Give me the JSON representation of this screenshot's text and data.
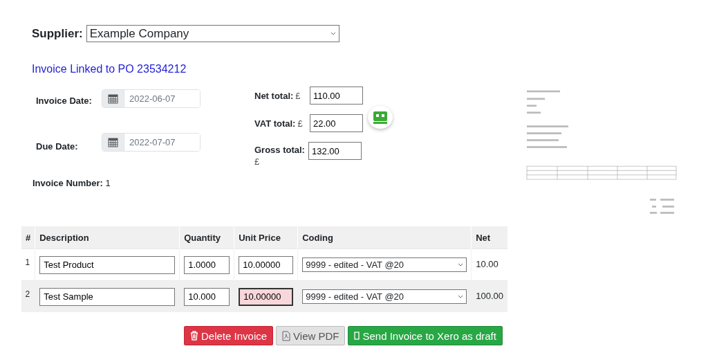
{
  "supplier": {
    "label": "Supplier:",
    "value": "Example Company"
  },
  "po_link": "Invoice Linked to PO 23534212",
  "dates": [
    {
      "label": "Invoice Date:",
      "placeholder": "2022-06-07"
    },
    {
      "label": "Due Date:",
      "placeholder": "2022-07-07"
    }
  ],
  "invoice_number": {
    "label": "Invoice Number:",
    "value": "1"
  },
  "totals": [
    {
      "label": "Net total:",
      "currency": "£",
      "value": "110.00"
    },
    {
      "label": "VAT total:",
      "currency": "£",
      "value": "22.00"
    },
    {
      "label": "Gross total:",
      "currency": "£",
      "value": "132.00"
    }
  ],
  "table": {
    "columns": [
      "#",
      "Description",
      "Quantity",
      "Unit Price",
      "Coding",
      "Net"
    ],
    "rows": [
      {
        "index": "1",
        "description": "Test Product",
        "quantity": "1.0000",
        "unit_price": "10.00000",
        "unit_price_invalid": false,
        "coding": "9999 - edited - VAT @20",
        "net": "10.00"
      },
      {
        "index": "2",
        "description": "Test Sample",
        "quantity": "10.000",
        "unit_price": "10.00000",
        "unit_price_invalid": true,
        "coding": "9999 - edited - VAT @20",
        "net": "100.00"
      }
    ]
  },
  "buttons": [
    {
      "kind": "danger",
      "label": "Delete Invoice"
    },
    {
      "kind": "secondary",
      "label": "View PDF"
    },
    {
      "kind": "success",
      "label": "Send Invoice to Xero as draft"
    }
  ]
}
